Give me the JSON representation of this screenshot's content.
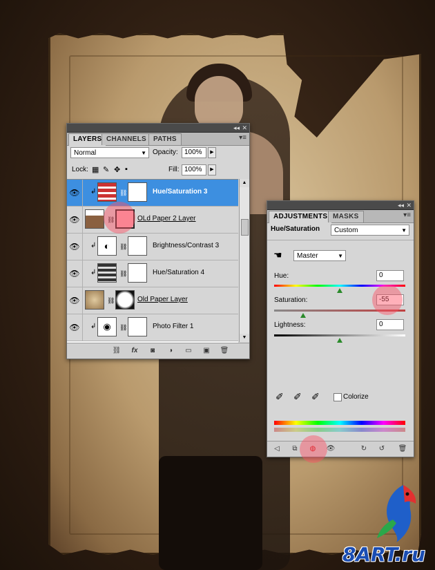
{
  "layers_panel": {
    "tabs": [
      "LAYERS",
      "CHANNELS",
      "PATHS"
    ],
    "blend_mode": "Normal",
    "opacity_label": "Opacity:",
    "opacity_value": "100%",
    "lock_label": "Lock:",
    "fill_label": "Fill:",
    "fill_value": "100%",
    "layers": [
      {
        "name": "Hue/Saturation 3",
        "selected": true
      },
      {
        "name": "OLd Paper 2 Layer",
        "selected": false
      },
      {
        "name": "Brightness/Contrast 3",
        "selected": false
      },
      {
        "name": "Hue/Saturation 4",
        "selected": false
      },
      {
        "name": "Old Paper Layer",
        "selected": false
      },
      {
        "name": "Photo Filter 1",
        "selected": false
      }
    ]
  },
  "adjustments_panel": {
    "tabs": [
      "ADJUSTMENTS",
      "MASKS"
    ],
    "title": "Hue/Saturation",
    "preset": "Custom",
    "channel": "Master",
    "hue_label": "Hue:",
    "hue_value": "0",
    "saturation_label": "Saturation:",
    "saturation_value": "-55",
    "lightness_label": "Lightness:",
    "lightness_value": "0",
    "colorize_label": "Colorize",
    "colorize_checked": false
  },
  "watermark": {
    "text": "8ART.ru"
  },
  "colors": {
    "selection": "#3d8fe0",
    "panel": "#d6d6d6",
    "highlight": "#ff5064"
  }
}
